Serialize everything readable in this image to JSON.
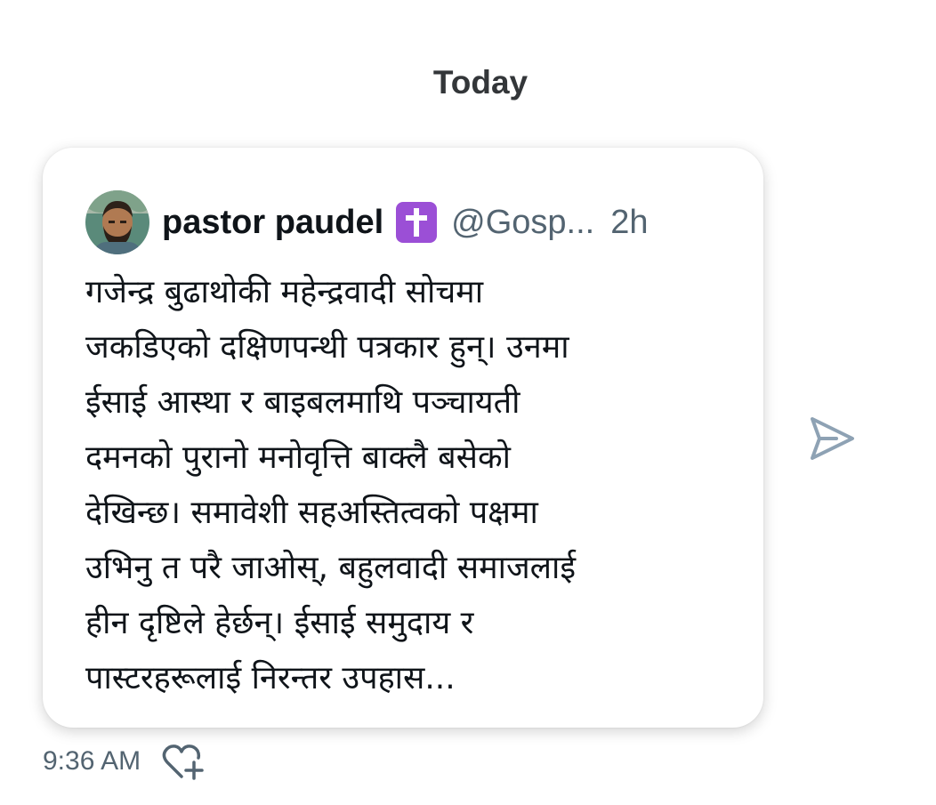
{
  "conversation": {
    "date_divider": "Today"
  },
  "message": {
    "quoted_post": {
      "author_name": "pastor paudel",
      "badge_icon": "latin-cross-icon",
      "badge_color": "#9b4fd6",
      "handle": "@Gosp...",
      "time_ago": "2h",
      "body_lines": [
        "गजेन्द्र बुढाथोकी महेन्द्रवादी सोचमा",
        "जकडिएको दक्षिणपन्थी पत्रकार हुन्। उनमा",
        "ईसाई आस्था र बाइबलमाथि पञ्चायती",
        "दमनको पुरानो मनोवृत्ति बाक्लै बसेको",
        "देखिन्छ। समावेशी सहअस्तित्वको पक्षमा",
        "उभिनु त परै जाओस्, बहुलवादी समाजलाई",
        "हीन दृष्टिले हेर्छन्। ईसाई समुदाय र",
        "पास्टरहरूलाई निरन्तर उपहास..."
      ]
    },
    "timestamp": "9:36 AM",
    "like_icon": "heart-plus-icon",
    "share_icon": "send-icon"
  },
  "colors": {
    "text_primary": "#0f1419",
    "text_secondary": "#536471",
    "icon_gray": "#8ea2b4"
  }
}
